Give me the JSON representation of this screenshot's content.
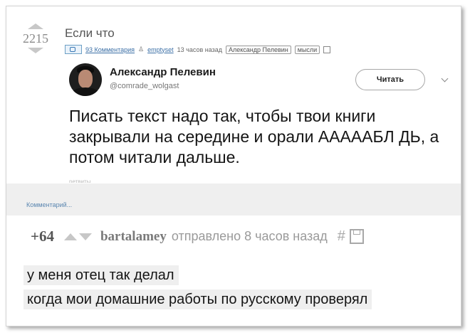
{
  "post": {
    "score": "2215",
    "title": "Если что",
    "comments_link": "93 Комментария",
    "author": "emptyset",
    "time": "13 часов назад",
    "tags": [
      "Александр Пелевин",
      "мысли"
    ]
  },
  "tweet": {
    "name": "Александр Пелевин",
    "handle": "@comrade_wolgast",
    "follow_label": "Читать",
    "text": "Писать текст надо так, чтобы твои книги закрывали на середине и орали АААААБЛ  ДЬ, а потом читали дальше.",
    "cut_text": "ретвиты"
  },
  "comment_input": {
    "placeholder": "Комментарий..."
  },
  "comment": {
    "score": "+64",
    "user": "bartalamey",
    "sent": "отправлено 8 часов назад",
    "hash": "#",
    "lines": [
      "у меня отец так делал",
      "когда мои домашние работы по русскому проверял"
    ]
  },
  "colors": {
    "background": "#ffffff",
    "strip": "#efefef",
    "link": "#3b6fa6",
    "vote_arrow": "#c8c8c8"
  }
}
